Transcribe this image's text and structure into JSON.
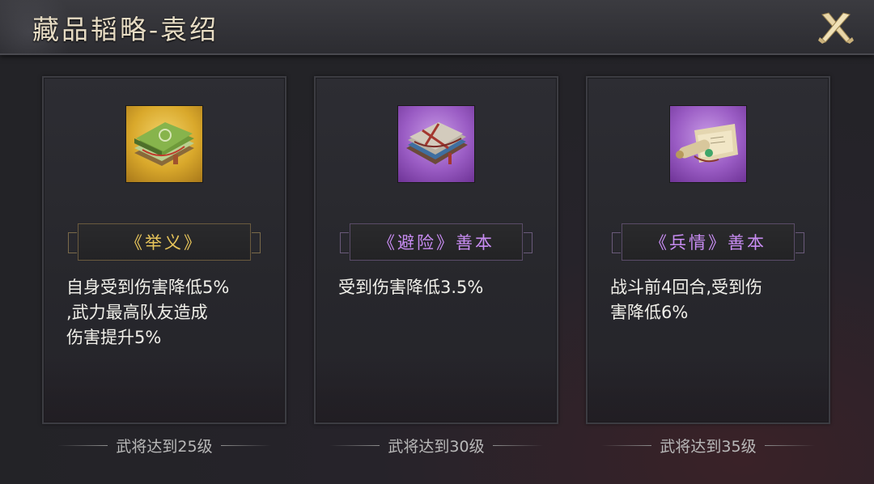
{
  "header": {
    "title": "藏品韬略-袁绍",
    "close_icon": "close-crossed-blades-icon"
  },
  "cards": [
    {
      "icon": "green-book-bundle-icon",
      "rarity": "gold",
      "name": "《举义》",
      "description": "自身受到伤害降低5%,武力最高队友造成伤害提升5%",
      "desc_lines": [
        "自身受到伤害降低5%",
        ",武力最高队友造成",
        "伤害提升5%"
      ],
      "requirement": "武将达到25级"
    },
    {
      "icon": "bound-book-icon",
      "rarity": "purple",
      "name": "《避险》善本",
      "description": "受到伤害降低3.5%",
      "desc_lines": [
        "受到伤害降低3.5%"
      ],
      "requirement": "武将达到30级"
    },
    {
      "icon": "scroll-icon",
      "rarity": "purple",
      "name": "《兵情》善本",
      "description": "战斗前4回合,受到伤害降低6%",
      "desc_lines": [
        "战斗前4回合,受到伤",
        "害降低6%"
      ],
      "requirement": "武将达到35级"
    }
  ],
  "colors": {
    "gold_name": "#e7c45a",
    "purple_name": "#c88cf2",
    "gold_frame": "#d9a82b",
    "purple_frame": "#9a5cc4"
  }
}
